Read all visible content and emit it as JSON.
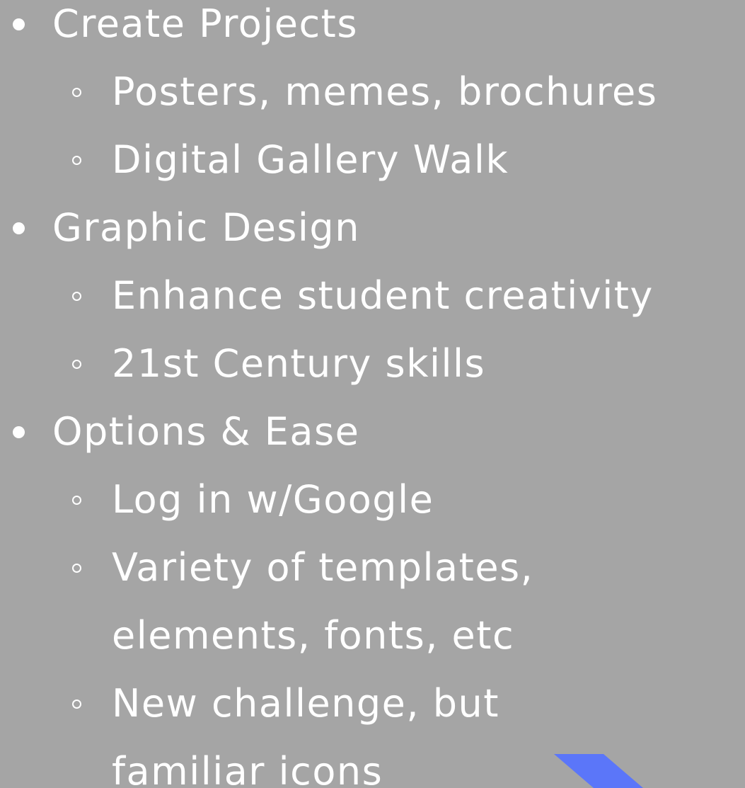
{
  "colors": {
    "background": "#a5a5a5",
    "text": "#ffffff",
    "accent": "#5b76f9"
  },
  "items": [
    {
      "label": "Create Projects",
      "subitems": [
        "Posters, memes, brochures",
        "Digital Gallery Walk"
      ]
    },
    {
      "label": "Graphic Design",
      "subitems": [
        "Enhance student creativity",
        "21st Century skills"
      ]
    },
    {
      "label": "Options & Ease",
      "subitems": [
        "Log in w/Google",
        "Variety of templates,",
        "elements, fonts, etc",
        "New challenge, but",
        "familiar icons"
      ]
    }
  ]
}
